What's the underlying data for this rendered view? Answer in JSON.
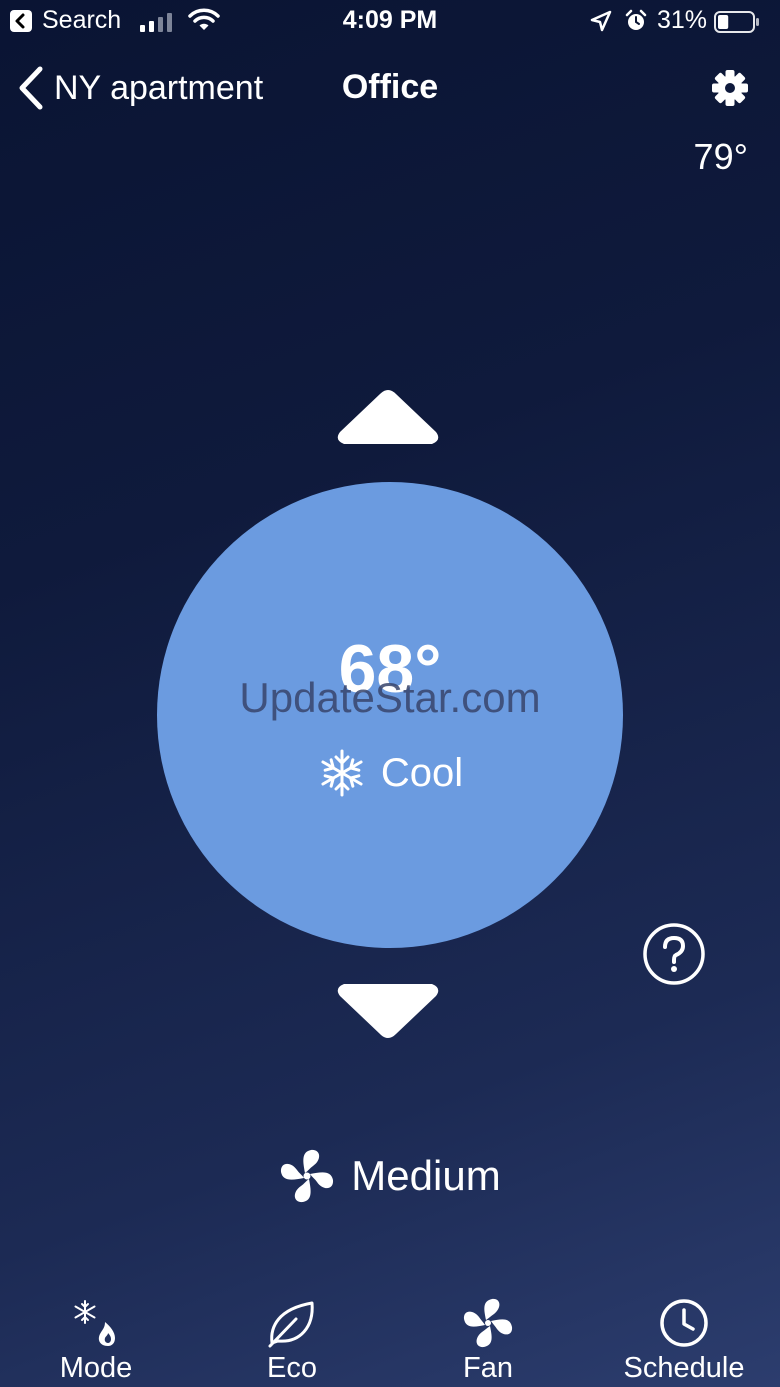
{
  "status_bar": {
    "back_app": "Search",
    "time": "4:09 PM",
    "battery_percent": "31%",
    "battery_level": 0.31,
    "icons": [
      "back-arrow-icon",
      "signal-icon",
      "wifi-icon",
      "location-icon",
      "alarm-icon",
      "battery-icon"
    ]
  },
  "nav": {
    "back_label": "NY apartment",
    "title": "Office",
    "settings_icon": "gear-icon"
  },
  "outdoor_temp": "79°",
  "thermostat": {
    "setpoint": "68°",
    "mode_label": "Cool",
    "mode_icon": "snowflake-icon",
    "dial_color": "#6b9be0",
    "watermark": "UpdateStar.com"
  },
  "fan": {
    "speed_label": "Medium",
    "icon": "fan-icon"
  },
  "help_icon": "question-icon",
  "tabs": [
    {
      "label": "Mode",
      "icon": "snowflake-flame-icon"
    },
    {
      "label": "Eco",
      "icon": "leaf-icon"
    },
    {
      "label": "Fan",
      "icon": "fan-icon"
    },
    {
      "label": "Schedule",
      "icon": "clock-icon"
    }
  ]
}
